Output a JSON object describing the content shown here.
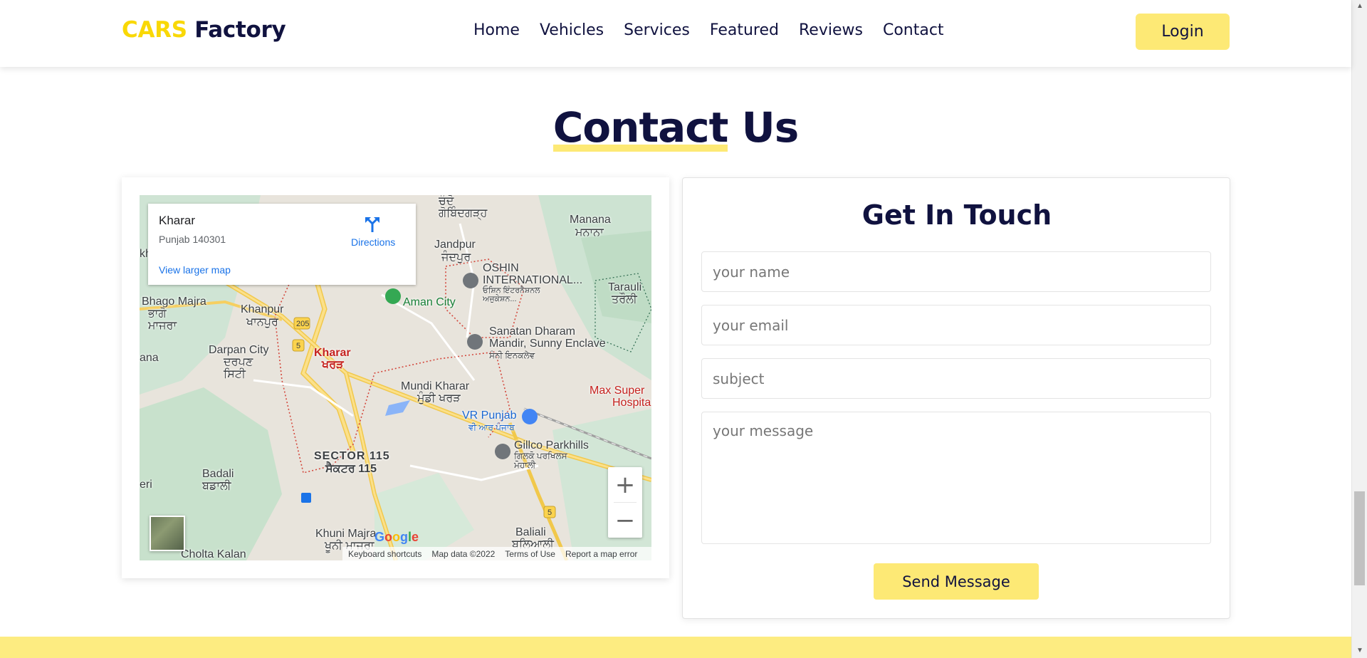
{
  "header": {
    "logo_accent": "CARS",
    "logo_main": "Factory",
    "nav": [
      "Home",
      "Vehicles",
      "Services",
      "Featured",
      "Reviews",
      "Contact"
    ],
    "login_label": "Login"
  },
  "section": {
    "heading_highlight": "Contact",
    "heading_rest": "Us"
  },
  "map": {
    "info_title": "Kharar",
    "info_address": "Punjab 140301",
    "directions_label": "Directions",
    "larger_map_label": "View larger map",
    "footer": {
      "keyboard": "Keyboard shortcuts",
      "map_data": "Map data ©2022",
      "terms": "Terms of Use",
      "report": "Report a map error"
    },
    "places": {
      "chandigarh": "ਚੰਦੋ ਗੋਬਿੰਦਗੜ੍ਹ",
      "manana": "Manana",
      "manana_pa": "ਮਨਾਨਾ",
      "jandpur": "Jandpur",
      "jandpur_pa": "ਜੰਦਪੁਰ",
      "oshin": "OSHIN",
      "oshin2": "INTERNATIONAL...",
      "oshin_pa": "ਓਸ਼ਿਨ ਇੰਟਰਨੈਸ਼ਨਲ ਅਜੁਕੇਸ਼ਨ...",
      "tarauli": "Tarauli",
      "tarauli_pa": "ਤਰੌਲੀ",
      "bhago": "Bhago Majra",
      "bhago_pa": "ਭਾਗੋ ਮਾਜਰਾ",
      "khanpur": "Khanpur",
      "khanpur_pa": "ਖਾਨਪੁਰ",
      "aman": "Aman City",
      "sanatan": "Sanatan Dharam",
      "sanatan2": "Mandir, Sunny Enclave",
      "sanatan_pa": "ਸੰਨੀ ਇਨਕਲੇਵ",
      "darpan": "Darpan City",
      "darpan_pa": "ਦਰਪਣ ਸਿਟੀ",
      "kharar": "Kharar",
      "kharar_pa": "ਖਰੜ",
      "ana": "ana",
      "mundi": "Mundi Kharar",
      "mundi_pa": "ਮੁੰਡੀ ਖਰੜ",
      "max": "Max Super",
      "max2": "Hospita",
      "vr": "VR Punjab",
      "vr_pa": "ਵੀ ਆਰ ਪੰਜਾਬ",
      "gillco": "Gillco Parkhills",
      "gillco_pa": "ਗਿਲਕੋ ਪਰਖਿਲਸ ਮੋਹਾਲੀ",
      "sector": "SECTOR 115",
      "sector_pa": "ਸੈਕਟਰ 115",
      "badali": "Badali",
      "badali_pa": "ਬਡਾਲੀ",
      "eri": "eri",
      "khuni": "Khuni Majra",
      "khuni_pa": "ਖੂਨੀ ਮਾਜਰਾ",
      "baliali": "Baliali",
      "baliali_pa": "ਬਲਿਆਲੀ",
      "cholta": "Cholta Kalan",
      "kh": "kh",
      "route205": "205",
      "route5a": "5",
      "route5b": "5"
    },
    "google": [
      "G",
      "o",
      "o",
      "g",
      "l",
      "e"
    ]
  },
  "form": {
    "title": "Get In Touch",
    "name_placeholder": "your name",
    "email_placeholder": "your email",
    "subject_placeholder": "subject",
    "message_placeholder": "your message",
    "send_label": "Send Message"
  },
  "colors": {
    "accent": "#f9d806",
    "button": "#fde975",
    "navy": "#10123f"
  }
}
